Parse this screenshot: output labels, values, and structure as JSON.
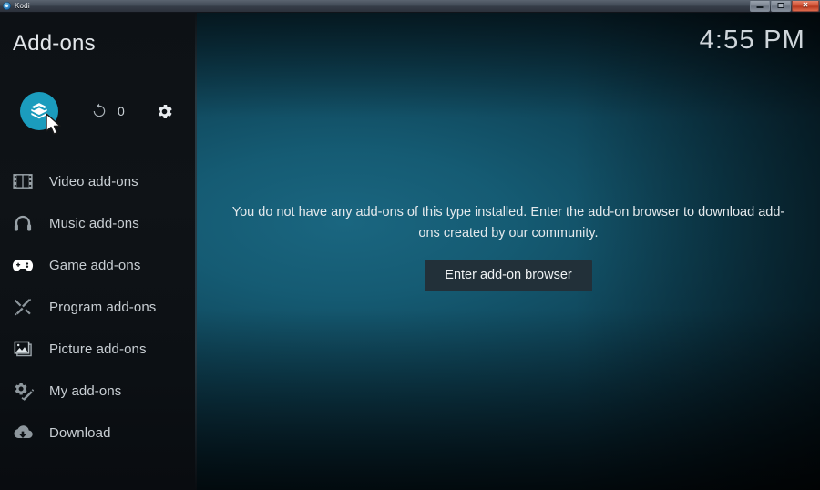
{
  "window": {
    "app_title": "Kodi",
    "logo_icon": "kodi-logo-icon",
    "controls": [
      {
        "name": "minimize",
        "glyph": ""
      },
      {
        "name": "maximize",
        "glyph": ""
      },
      {
        "name": "close",
        "glyph": "✕"
      }
    ]
  },
  "header": {
    "page_title": "Add-ons",
    "clock": "4:55 PM"
  },
  "toolbar": {
    "browser_button": {
      "icon": "addon-box-icon",
      "label": "",
      "accent_color": "#1b9cbd",
      "focused": true
    },
    "refresh_button": {
      "icon": "refresh-icon",
      "count": "0"
    },
    "settings_button": {
      "icon": "gear-icon"
    }
  },
  "sidebar": {
    "items": [
      {
        "label": "Video add-ons",
        "icon": "film-strip-icon",
        "active": false
      },
      {
        "label": "Music add-ons",
        "icon": "headphones-icon",
        "active": false
      },
      {
        "label": "Game add-ons",
        "icon": "gamepad-icon",
        "active": true
      },
      {
        "label": "Program add-ons",
        "icon": "tools-icon",
        "active": false
      },
      {
        "label": "Picture add-ons",
        "icon": "picture-icon",
        "active": false
      },
      {
        "label": "My add-ons",
        "icon": "gear-wrench-icon",
        "active": false
      },
      {
        "label": "Download",
        "icon": "cloud-download-icon",
        "active": false
      }
    ]
  },
  "main": {
    "empty_message": "You do not have any add-ons of this type installed. Enter the add-on browser to download add-ons created by our community.",
    "enter_button_label": "Enter add-on browser"
  },
  "colors": {
    "accent": "#1b9cbd",
    "background_teal": "#155b73",
    "sidebar": "#0d1115",
    "button": "#223039",
    "text": "#c8ced3"
  }
}
